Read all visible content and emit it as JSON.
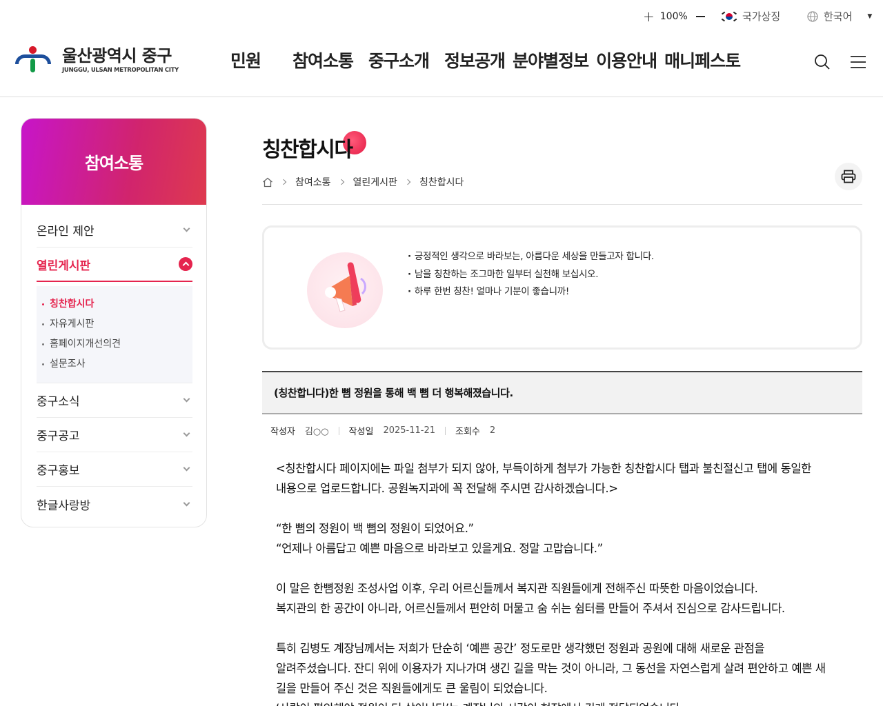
{
  "util": {
    "zoom_in": "+",
    "zoom_level": "100%",
    "symbol_label": "국가상징",
    "language": "한국어"
  },
  "logo": {
    "name_kr": "울산광역시 중구",
    "name_en": "JUNGGU, ULSAN METROPOLITAN CITY"
  },
  "gnb": [
    "민원",
    "참여소통",
    "중구소개",
    "정보공개",
    "분야별정보",
    "이용안내",
    "매니페스토"
  ],
  "lnb": {
    "title": "참여소통",
    "items": [
      {
        "label": "온라인 제안"
      },
      {
        "label": "열린게시판"
      },
      {
        "label": "중구소식"
      },
      {
        "label": "중구공고"
      },
      {
        "label": "중구홍보"
      },
      {
        "label": "한글사랑방"
      }
    ],
    "sub_items": [
      "칭찬합시다",
      "자유게시판",
      "홈페이지개선의견",
      "설문조사"
    ]
  },
  "page": {
    "title": "칭찬합시다",
    "breadcrumb": [
      "참여소통",
      "열린게시판",
      "칭찬합시다"
    ]
  },
  "notice": [
    "긍정적인 생각으로 바라보는, 아름다운 세상을 만들고자 합니다.",
    "남을 칭찬하는 조그마한 일부터 실천해 보십시오.",
    "하루 한번 칭찬! 얼마나 기분이 좋습니까!"
  ],
  "post": {
    "title": "(칭찬합니다)한 뼘 정원을 통해 백 뼘 더 행복해졌습니다.",
    "author_label": "작성자",
    "author": "김○○",
    "date_label": "작성일",
    "date": "2025-11-21",
    "views_label": "조회수",
    "views": "2",
    "body": [
      "<칭찬합시다 페이지에는 파일 첨부가 되지 않아, 부득이하게 첨부가 가능한 칭찬합시다 탭과 불친절신고 탭에 동일한",
      "내용으로 업로드합니다. 공원녹지과에 꼭 전달해 주시면 감사하겠습니다.>",
      "",
      "“한 뼘의 정원이 백 뼘의 정원이 되었어요.”",
      "“언제나 아름답고 예쁜 마음으로 바라보고 있을게요. 정말 고맙습니다.”",
      "",
      "이 말은 한뼘정원 조성사업 이후, 우리 어르신들께서 복지관 직원들에게 전해주신 따뜻한 마음이었습니다.",
      "복지관의 한 공간이 아니라, 어르신들께서 편안히 머물고 숨 쉬는 쉼터를 만들어 주셔서 진심으로 감사드립니다.",
      "",
      "특히 김병도 계장님께서는 저희가 단순히 ‘예쁜 공간’ 정도로만 생각했던 정원과 공원에 대해 새로운 관점을",
      "알려주셨습니다. 잔디 위에 이용자가 지나가며 생긴 길을 막는 것이 아니라, 그 동선을 자연스럽게 살려 편안하고 예쁜 새",
      "길을 만들어 주신 것은 직원들에게도 큰 울림이 되었습니다.",
      "‘사람이 편안해야 정원이 더 살아난다’는 계장님의 시각이 현장에서 깊게 전달되었습니다."
    ]
  },
  "colors": {
    "accent": "#e5244e",
    "lnb_gradient_start": "#c715c9",
    "lnb_gradient_end": "#de3a4f"
  }
}
